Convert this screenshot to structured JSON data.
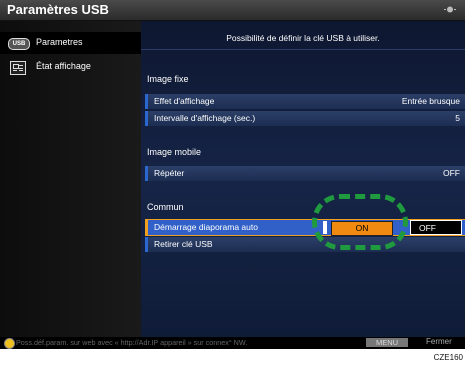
{
  "window": {
    "title": "Paramètres USB"
  },
  "sidebar": {
    "items": [
      {
        "label": "Parametres",
        "icon": "usb-icon"
      },
      {
        "label": "État affichage",
        "icon": "display-status-icon"
      }
    ]
  },
  "main": {
    "description": "Possibilité de définir la clé USB à utiliser.",
    "sections": {
      "image_fixe": {
        "title": "Image fixe",
        "rows": [
          {
            "label": "Effet d'affichage",
            "value": "Entrée brusque"
          },
          {
            "label": "Intervalle d'affichage (sec.)",
            "value": "5"
          }
        ]
      },
      "image_mobile": {
        "title": "Image mobile",
        "rows": [
          {
            "label": "Répéter",
            "value": "OFF"
          }
        ]
      },
      "commun": {
        "title": "Commun",
        "rows": [
          {
            "label": "Démarrage diaporama auto",
            "on": "ON",
            "off": "OFF"
          },
          {
            "label": "Retirer clé USB"
          }
        ]
      }
    }
  },
  "status": {
    "hint": "Poss.déf.param. sur web avec « http://Adr.IP appareil » sur connex° NW.",
    "menu_label": "MENU",
    "close_label": "Fermer"
  },
  "figure_code": "CZE160",
  "colors": {
    "accent": "#f08a10",
    "highlight": "#1f9a3e",
    "selection": "#3060c8"
  }
}
